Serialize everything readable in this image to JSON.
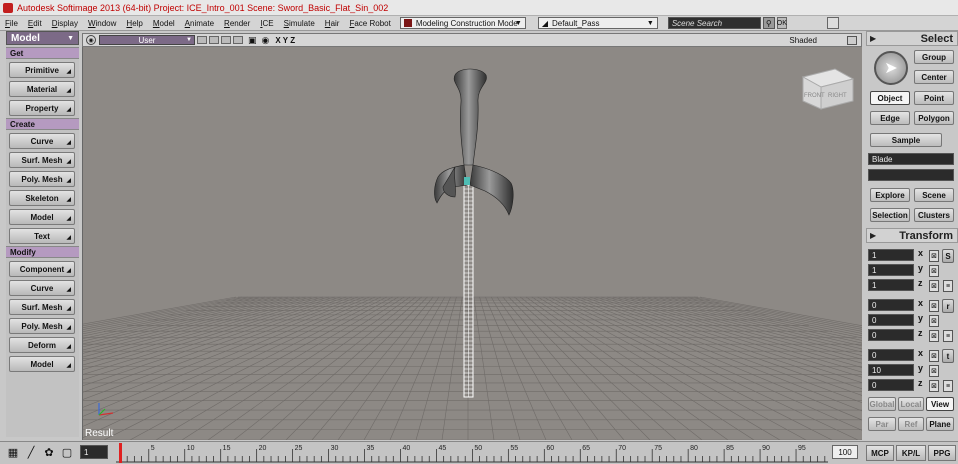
{
  "window": {
    "title": "Autodesk Softimage 2013 (64-bit)     Project: ICE_Intro_001     Scene: Sword_Basic_Flat_Sin_002"
  },
  "menubar": {
    "items": [
      "File",
      "Edit",
      "Display",
      "Window",
      "Help",
      "Model",
      "Animate",
      "Render",
      "ICE",
      "Simulate",
      "Hair",
      "Face Robot"
    ],
    "mode_select": "Modeling Construction Mode",
    "pass_select": "Default_Pass",
    "search_placeholder": "Scene Search",
    "ok_label": "OK"
  },
  "left_panel": {
    "title": "Model",
    "sections": [
      {
        "label": "Get",
        "buttons": [
          "Primitive",
          "Material",
          "Property"
        ]
      },
      {
        "label": "Create",
        "buttons": [
          "Curve",
          "Surf. Mesh",
          "Poly. Mesh",
          "Skeleton",
          "Model",
          "Text"
        ]
      },
      {
        "label": "Modify",
        "buttons": [
          "Component",
          "Curve",
          "Surf. Mesh",
          "Poly. Mesh",
          "Deform",
          "Model"
        ]
      }
    ]
  },
  "viewport": {
    "camera": "User",
    "axes": "X Y Z",
    "display_mode": "Shaded",
    "result_label": "Result",
    "cube_front": "FRONT",
    "cube_right": "RIGHT"
  },
  "right_panel": {
    "select_title": "Select",
    "group_label": "Group",
    "center_label": "Center",
    "object_label": "Object",
    "point_label": "Point",
    "edge_label": "Edge",
    "polygon_label": "Polygon",
    "sample_label": "Sample",
    "selection_name": "Blade",
    "explore_label": "Explore",
    "scene_label": "Scene",
    "selection_label": "Selection",
    "clusters_label": "Clusters",
    "transform_title": "Transform",
    "scale": {
      "x": "1",
      "y": "1",
      "z": "1"
    },
    "rotate": {
      "x": "0",
      "y": "0",
      "z": "0"
    },
    "translate": {
      "x": "0",
      "y": "10",
      "z": "0"
    },
    "scale_btn": "S",
    "rotate_btn": "r",
    "translate_btn": "t",
    "global_label": "Global",
    "local_label": "Local",
    "view_label": "View",
    "par_label": "Par",
    "ref_label": "Ref",
    "plane_label": "Plane"
  },
  "timeline": {
    "start_frame": "1",
    "end_frame": "100",
    "ticks": [
      "5",
      "10",
      "15",
      "20",
      "25",
      "30",
      "35",
      "40",
      "45",
      "50",
      "55",
      "60",
      "65",
      "70",
      "75",
      "80",
      "85",
      "90",
      "95"
    ],
    "current_frame": 1
  },
  "bottom_tabs": [
    "MCP",
    "KP/L",
    "PPG"
  ]
}
